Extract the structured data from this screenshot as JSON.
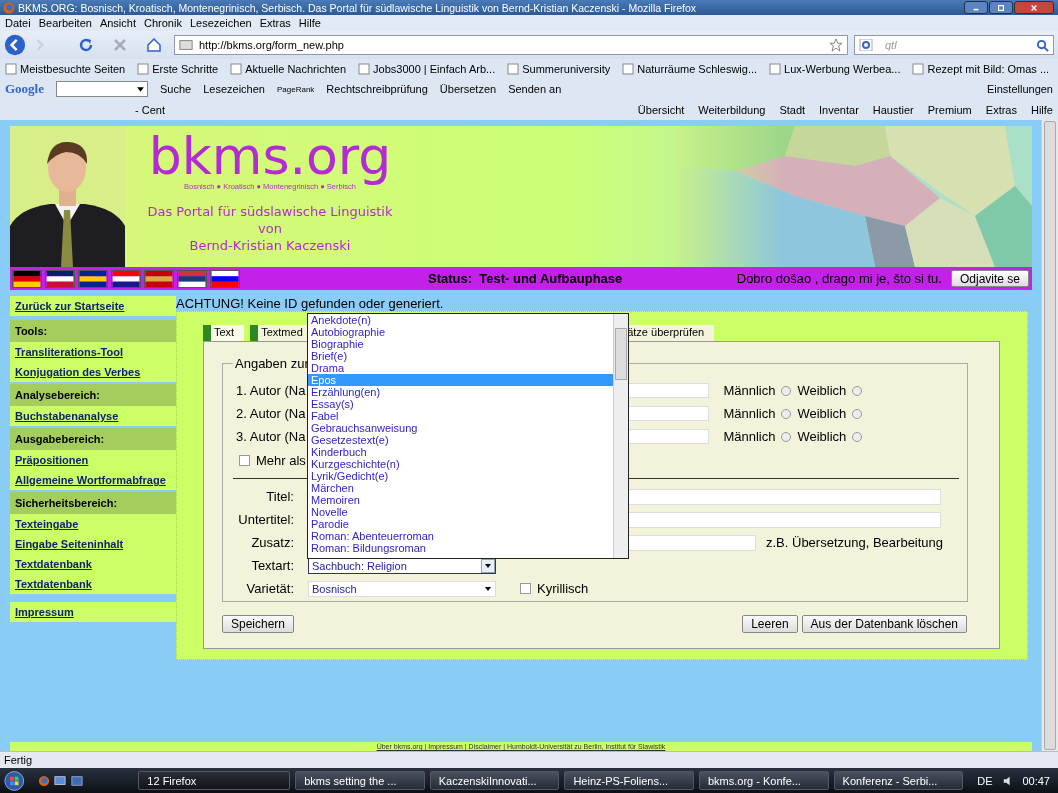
{
  "window": {
    "title": "BKMS.ORG: Bosnisch, Kroatisch, Montenegrinisch, Serbisch. Das Portal für südlawische Linguistik von Bernd-Kristian Kaczenski - Mozilla Firefox"
  },
  "menu": [
    "Datei",
    "Bearbeiten",
    "Ansicht",
    "Chronik",
    "Lesezeichen",
    "Extras",
    "Hilfe"
  ],
  "navigation": {
    "url": "http://bkms.org/form_new.php",
    "search": "qtl"
  },
  "bookmarks": [
    "Meistbesuchte Seiten",
    "Erste Schritte",
    "Aktuelle Nachrichten",
    "Jobs3000 | Einfach Arb...",
    "Summeruniversity",
    "Naturräume Schleswig...",
    "Lux-Werbung Werbea...",
    "Rezept mit Bild: Omas ..."
  ],
  "google_toolbar": {
    "logo": "Google",
    "items": [
      "Suche",
      "Lesezeichen",
      "PageRank",
      "Rechtschreibprüfung",
      "Übersetzen",
      "Senden an"
    ],
    "settings": "Einstellungen"
  },
  "extra_toolbar": {
    "left": [
      "- Cent"
    ],
    "right": [
      "Übersicht",
      "Weiterbildung",
      "Stadt",
      "Inventar",
      "Haustier",
      "Premium",
      "Extras",
      "Hilfe"
    ]
  },
  "header": {
    "logo": "bkms.org",
    "languages": "Bosnisch ● Kroatisch ● Montenegrinisch ● Serbisch",
    "tagline": [
      "Das Portal für südslawische Linguistik",
      "von",
      "Bernd-Kristian Kaczenski"
    ]
  },
  "site_bar": {
    "status_label": "Status:",
    "status": "Test- und Aufbauphase",
    "greeting": "Dobro došao , drago mi je, što si tu.",
    "logout": "Odjavite se"
  },
  "sidebar": {
    "items": [
      {
        "kind": "link",
        "label": "Zurück zur Startseite"
      },
      {
        "kind": "heading",
        "label": "Tools:"
      },
      {
        "kind": "link",
        "label": "Transliterations-Tool"
      },
      {
        "kind": "link",
        "label": "Konjugation des Verbes"
      },
      {
        "kind": "heading",
        "label": "Analysebereich:"
      },
      {
        "kind": "link",
        "label": "Buchstabenanalyse"
      },
      {
        "kind": "heading",
        "label": "Ausgabebereich:"
      },
      {
        "kind": "link",
        "label": "Präpositionen"
      },
      {
        "kind": "link",
        "label": "Allgemeine Wortformabfrage"
      },
      {
        "kind": "heading",
        "label": "Sicherheitsbereich:"
      },
      {
        "kind": "link",
        "label": "Texteingabe"
      },
      {
        "kind": "link",
        "label": "Eingabe  Seiteninhalt"
      },
      {
        "kind": "link",
        "label": "Textdatenbank"
      },
      {
        "kind": "link",
        "label": "Textdatenbank"
      }
    ],
    "bottom_items": [
      {
        "kind": "link",
        "label": "Impressum"
      }
    ]
  },
  "notice": "ACHTUNG! Keine ID gefunden oder generiert.",
  "tabs": [
    {
      "label": "Text",
      "selected": true
    },
    {
      "label": "Textmed",
      "selected": false
    },
    {
      "label": "ätze überprüfen",
      "selected": false
    }
  ],
  "form": {
    "legend": "Angaben zur",
    "authors": [
      {
        "label": "1. Autor (Na",
        "male_label": "Männlich",
        "male": false,
        "female_label": "Weiblich",
        "female": false
      },
      {
        "label": "2. Autor (Na",
        "male_label": "Männlich",
        "male": false,
        "female_label": "Weiblich",
        "female": false
      },
      {
        "label": "3. Autor (Na",
        "male_label": "Männlich",
        "male": false,
        "female_label": "Weiblich",
        "female": false
      }
    ],
    "more": {
      "label": "Mehr als",
      "checked": false
    },
    "fields": [
      {
        "label": "Titel:",
        "kind": "wide"
      },
      {
        "label": "Untertitel:",
        "kind": "wide"
      },
      {
        "label": "Zusatz:",
        "kind": "short",
        "hint": "z.B. Übersetzung, Bearbeitung"
      }
    ],
    "textart": {
      "label": "Textart:",
      "value": "Sachbuch: Religion",
      "options": [
        {
          "label": "Anekdote(n)",
          "selected": false
        },
        {
          "label": "Autobiographie",
          "selected": false
        },
        {
          "label": "Biographie",
          "selected": false
        },
        {
          "label": "Brief(e)",
          "selected": false
        },
        {
          "label": "Drama",
          "selected": false
        },
        {
          "label": "Epos",
          "selected": true
        },
        {
          "label": "Erzählung(en)",
          "selected": false
        },
        {
          "label": "Essay(s)",
          "selected": false
        },
        {
          "label": "Fabel",
          "selected": false
        },
        {
          "label": "Gebrauchsanweisung",
          "selected": false
        },
        {
          "label": "Gesetzestext(e)",
          "selected": false
        },
        {
          "label": "Kinderbuch",
          "selected": false
        },
        {
          "label": "Kurzgeschichte(n)",
          "selected": false
        },
        {
          "label": "Lyrik/Gedicht(e)",
          "selected": false
        },
        {
          "label": "Märchen",
          "selected": false
        },
        {
          "label": "Memoiren",
          "selected": false
        },
        {
          "label": "Novelle",
          "selected": false
        },
        {
          "label": "Parodie",
          "selected": false
        },
        {
          "label": "Roman: Abenteuerroman",
          "selected": false
        },
        {
          "label": "Roman: Bildungsroman",
          "selected": false
        }
      ]
    },
    "variety": {
      "label": "Varietät:",
      "value": "Bosnisch"
    },
    "cyrillic": {
      "label": "Kyrillisch",
      "checked": false
    },
    "buttons": {
      "save": "Speichern",
      "clear": "Leeren",
      "delete": "Aus der Datenbank löschen"
    }
  },
  "footer": "Über bkms.org | Impressum | Disclaimer | Humboldt-Universität zu Berlin, Institut für Slawistik",
  "status": "Fertig",
  "taskbar": {
    "tasks": [
      {
        "label": "12 Firefox",
        "selected": true
      },
      {
        "label": "bkms setting the ...",
        "selected": false
      },
      {
        "label": "KaczenskiInnovati...",
        "selected": false
      },
      {
        "label": "Heinz-PS-Foliens...",
        "selected": false
      },
      {
        "label": "bkms.org - Konfe...",
        "selected": false
      },
      {
        "label": "Konferenz - Serbi...",
        "selected": false
      }
    ],
    "language": "DE",
    "clock": "00:47"
  }
}
